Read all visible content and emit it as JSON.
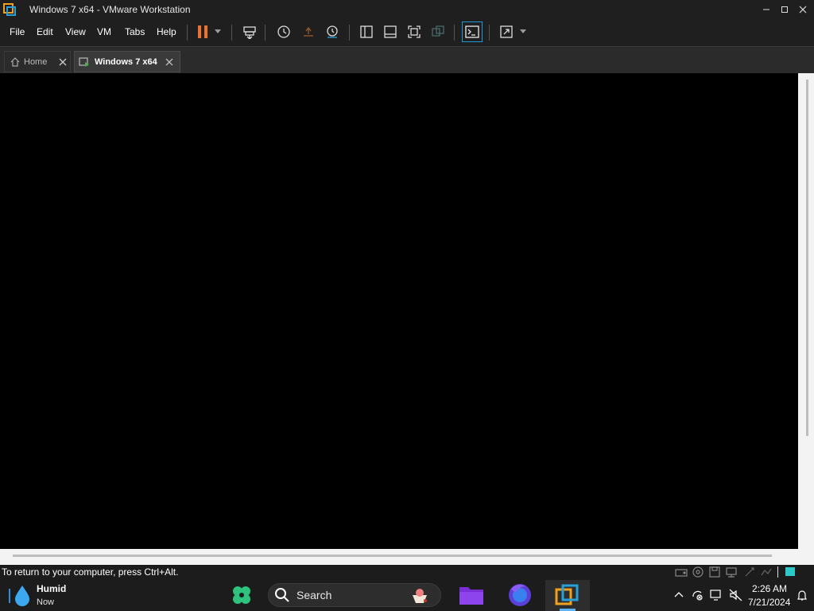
{
  "window": {
    "title": "Windows 7 x64 - VMware Workstation",
    "controls": [
      "minimize",
      "maximize",
      "close"
    ]
  },
  "menu": [
    "File",
    "Edit",
    "View",
    "VM",
    "Tabs",
    "Help"
  ],
  "toolbar_icons": [
    "pause-icon",
    "dropdown-arrow-icon",
    "send-ctrl-alt-del-icon",
    "snapshot-icon",
    "revert-snapshot-icon",
    "snapshot-manager-icon",
    "show-library-icon",
    "thumbnail-bar-icon",
    "full-screen-icon",
    "unity-icon",
    "console-view-icon",
    "stretch-guest-icon"
  ],
  "tabs": [
    {
      "label": "Home",
      "active": false
    },
    {
      "label": "Windows 7 x64",
      "active": true
    }
  ],
  "status": {
    "message": "To return to your computer, press Ctrl+Alt."
  },
  "taskbar": {
    "weather_title": "Humid",
    "weather_sub": "Now",
    "search_placeholder": "Search",
    "time": "2:26 AM",
    "date": "7/21/2024"
  },
  "colors": {
    "pause_orange": "#f0722a",
    "vmware_accent": "#1c9bd6",
    "folder_purple": "#7a2fd6"
  }
}
